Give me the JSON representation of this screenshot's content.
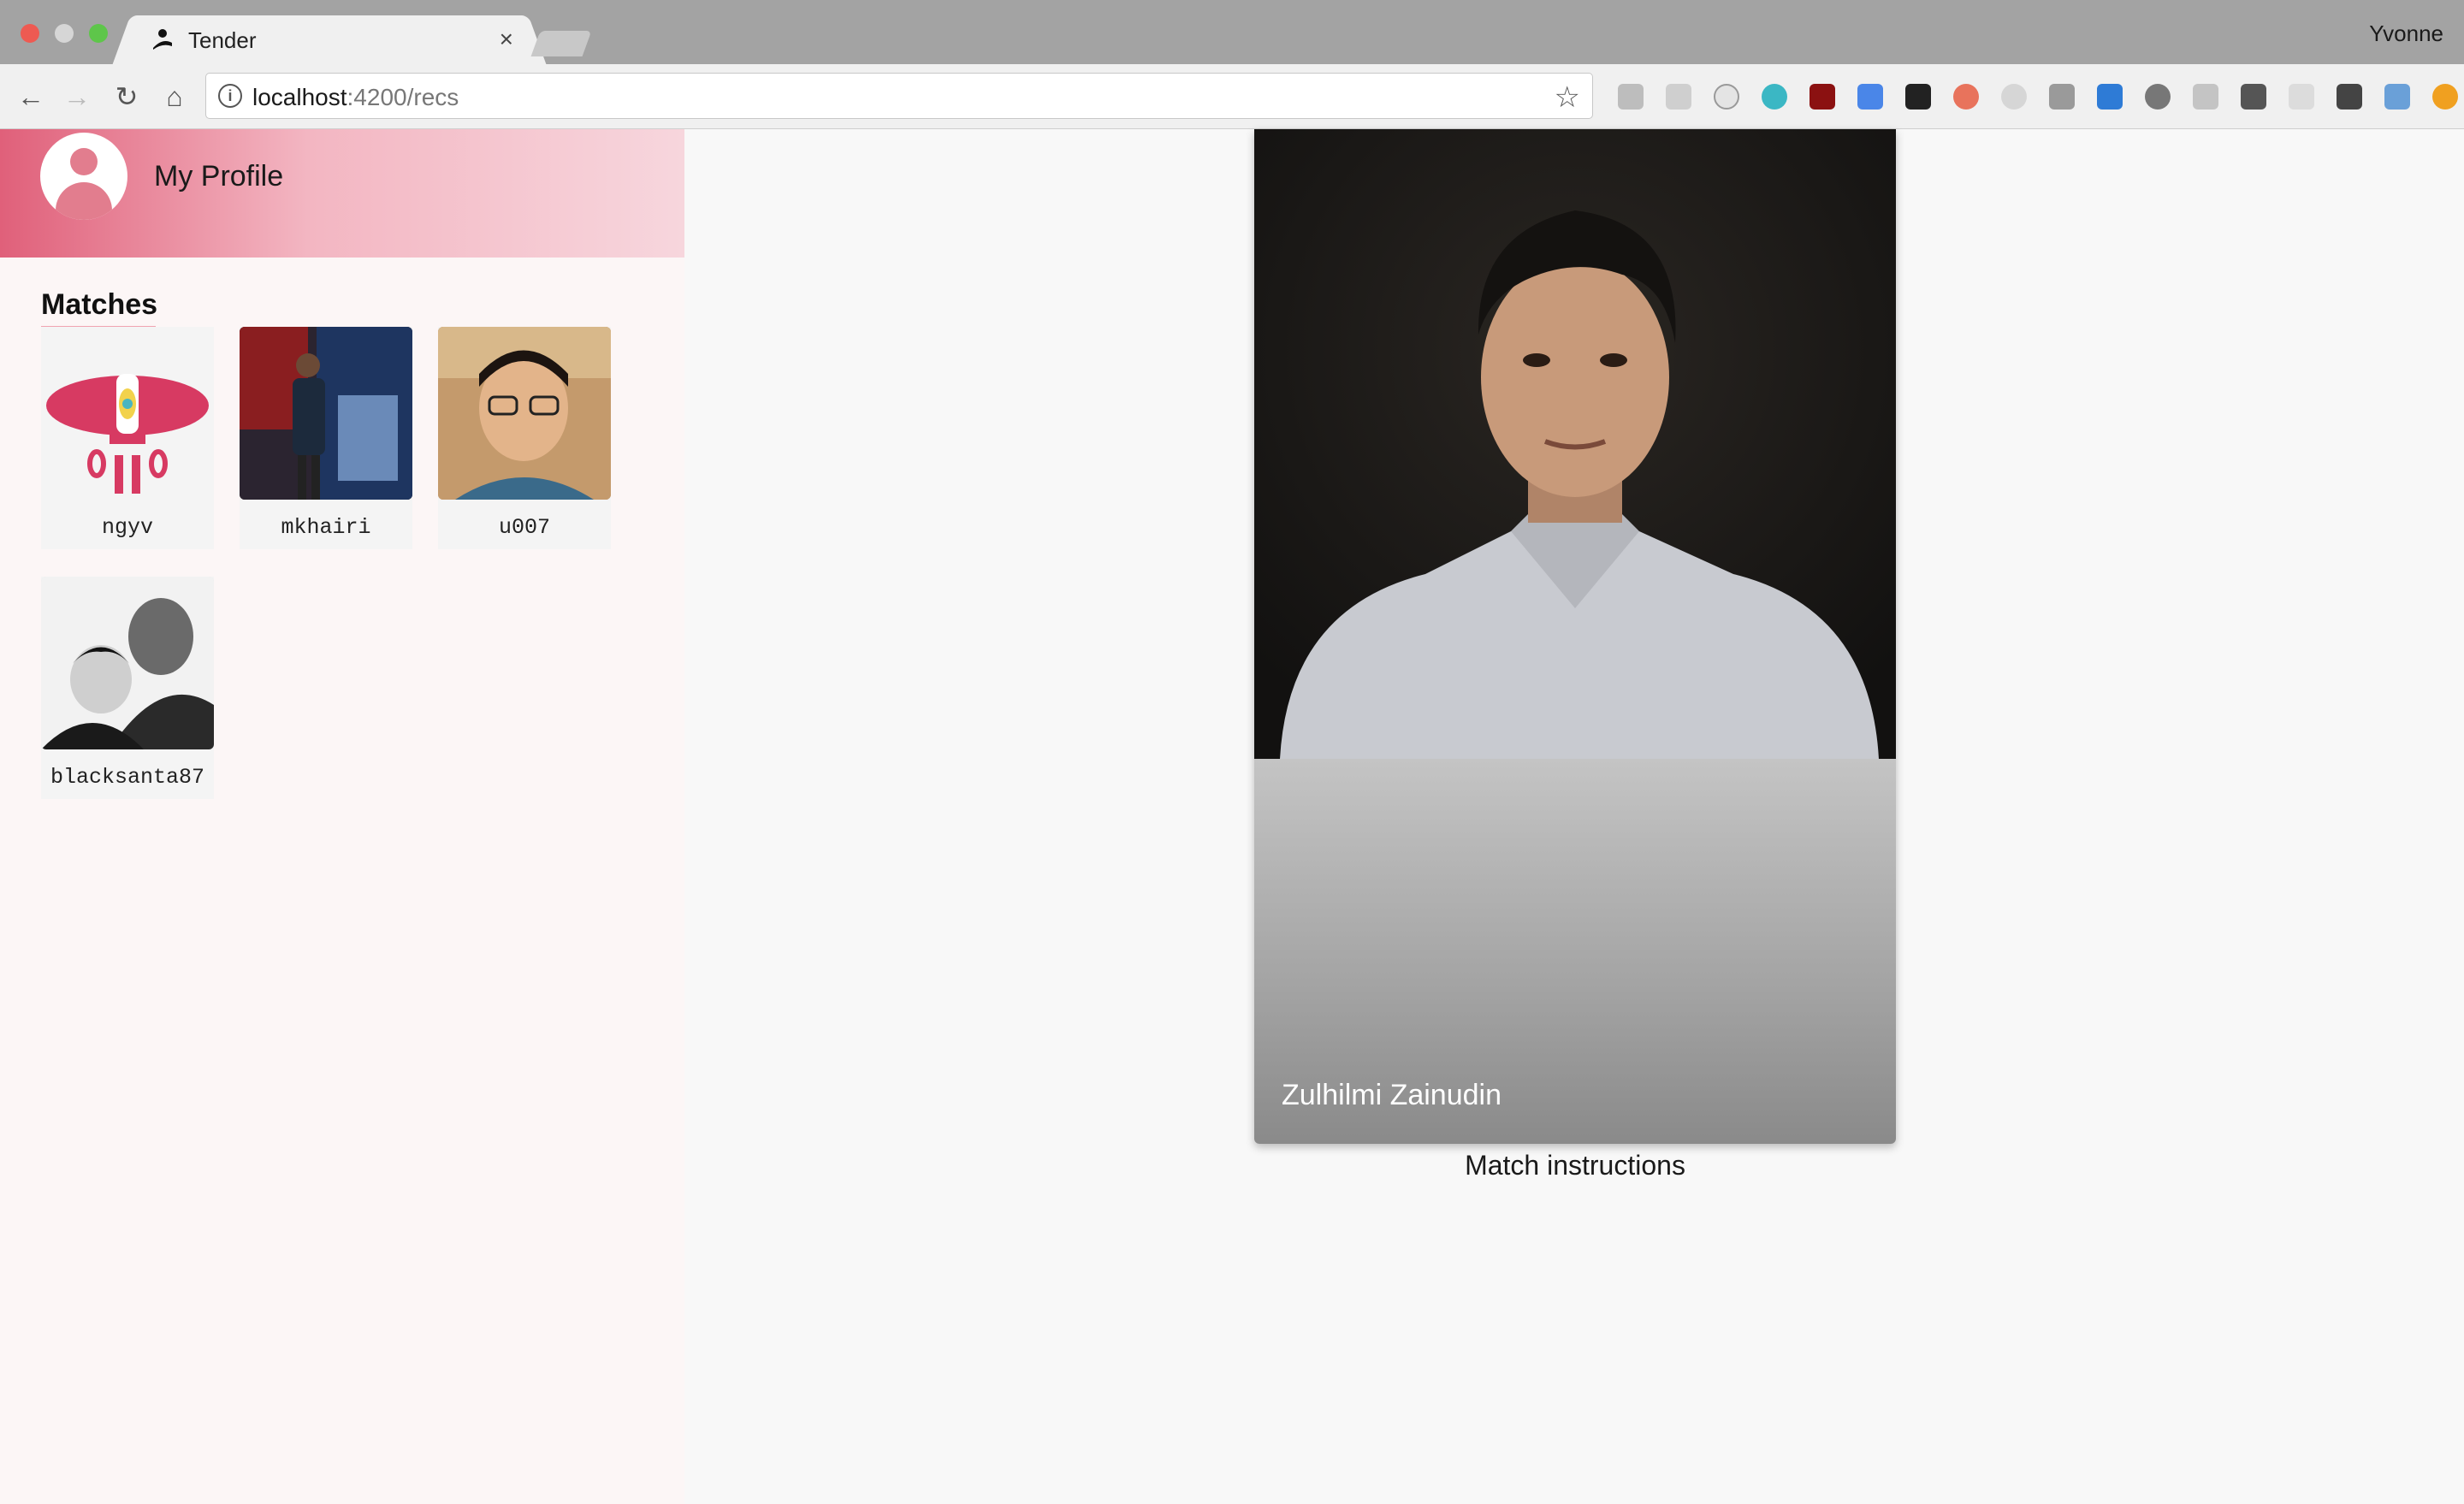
{
  "browser": {
    "tab_title": "Tender",
    "profile_name": "Yvonne",
    "url_host": "localhost",
    "url_rest": ":4200/recs"
  },
  "sidebar": {
    "profile_label": "My Profile",
    "matches_title": "Matches",
    "matches": [
      {
        "username": "ngyv"
      },
      {
        "username": "mkhairi"
      },
      {
        "username": "u007"
      },
      {
        "username": "blacksanta87"
      }
    ]
  },
  "recommendation": {
    "name": "Zulhilmi Zainudin",
    "instructions": "Match instructions"
  },
  "colors": {
    "accent": "#e0607a",
    "sidebar_bg": "#fcf6f6"
  }
}
